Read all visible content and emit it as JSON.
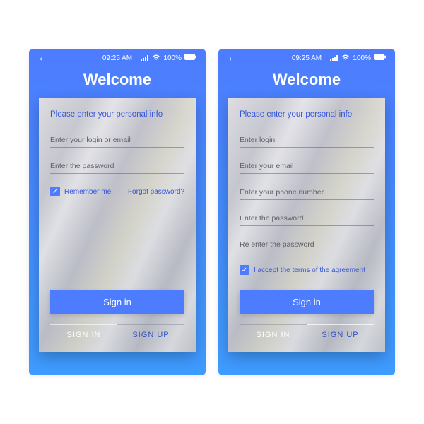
{
  "status": {
    "time": "09:25 AM",
    "battery_pct": "100%"
  },
  "title": "Welcome",
  "subtitle": "Please enter your personal info",
  "login_screen": {
    "login_placeholder": "Enter your login or email",
    "password_placeholder": "Enter the password",
    "remember_label": "Remember me",
    "forgot_label": "Forgot password?",
    "primary_button": "Sign in",
    "tab_signin": "SIGN IN",
    "tab_signup": "SIGN UP"
  },
  "signup_screen": {
    "login_placeholder": "Enter login",
    "email_placeholder": "Enter your email",
    "phone_placeholder": "Enter your phone number",
    "password_placeholder": "Enter the password",
    "password2_placeholder": "Re enter the password",
    "terms_label": "I accept the terms of the agreement",
    "primary_button": "Sign in",
    "tab_signin": "SIGN IN",
    "tab_signup": "SIGN UP"
  }
}
